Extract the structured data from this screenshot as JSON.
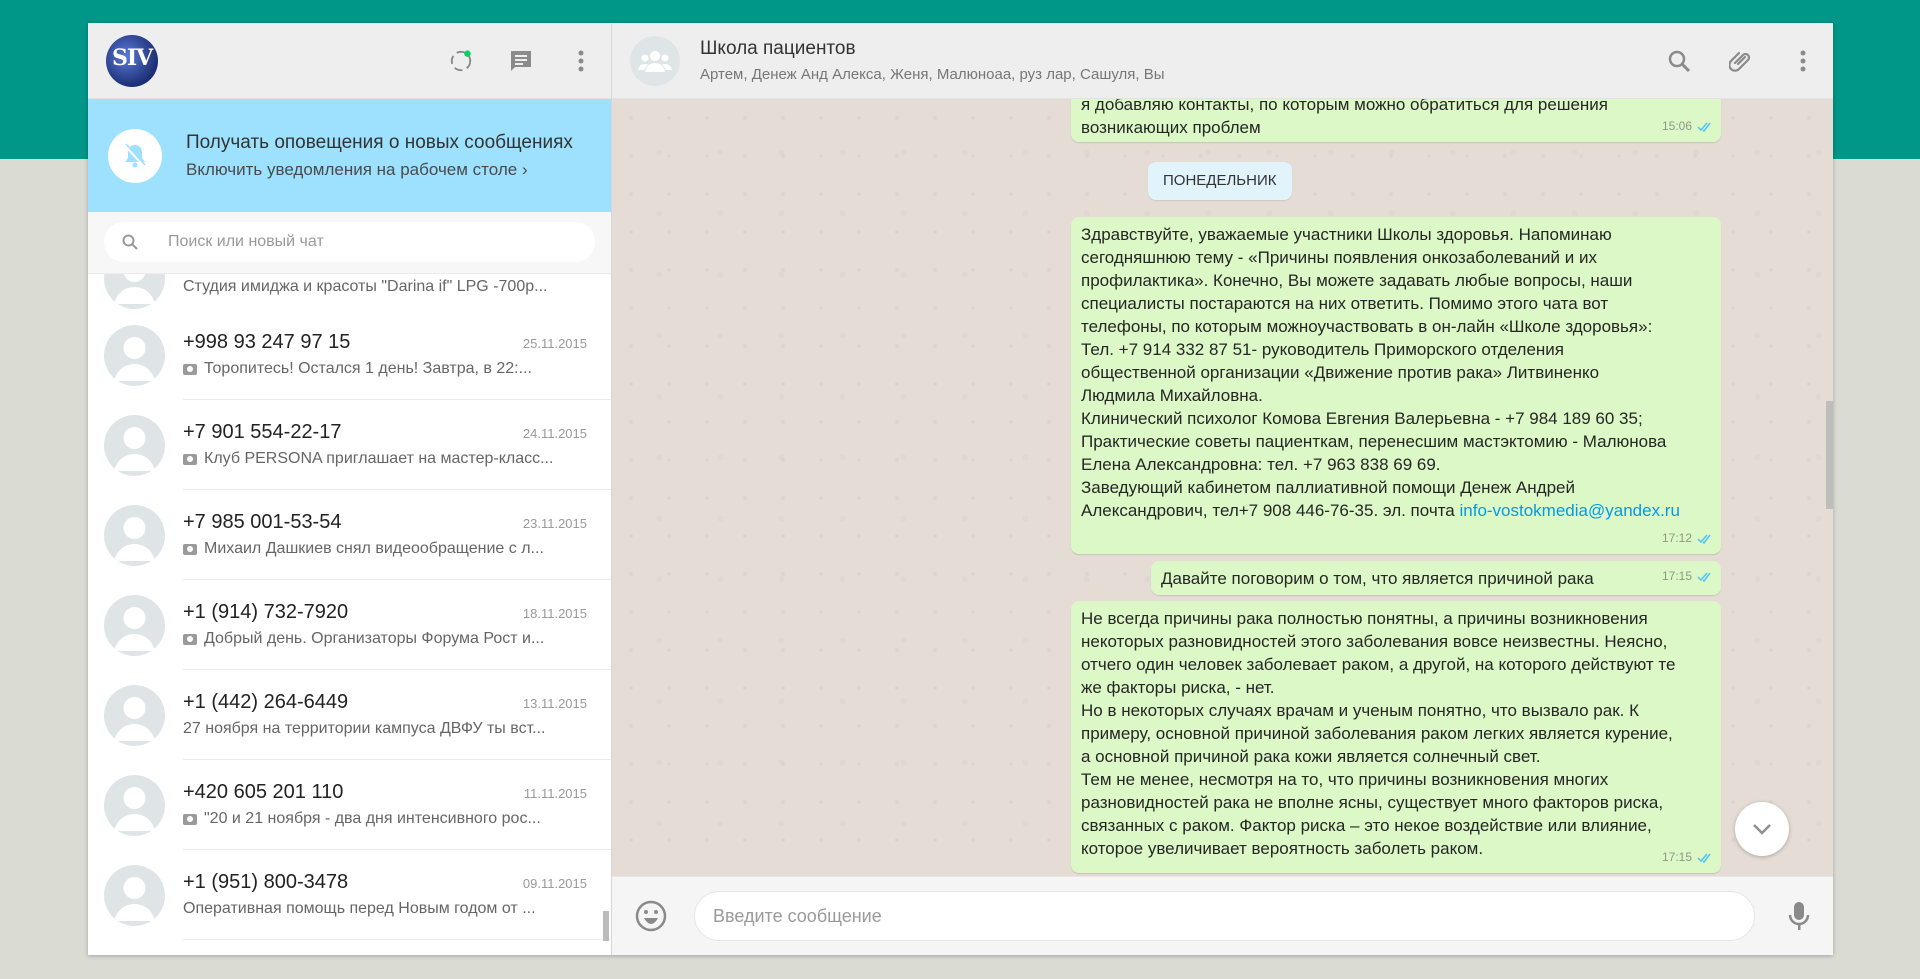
{
  "sidebar": {
    "notification": {
      "title": "Получать оповещения о новых сообщениях",
      "link": "Включить уведомления на рабочем столе ›"
    },
    "search": {
      "placeholder": "Поиск или новый чат"
    },
    "partial_chat": {
      "preview": "Студия имиджа и красоты \"Darina if\" LPG -700р..."
    },
    "chats": [
      {
        "name": "+998 93 247 97 15",
        "date": "25.11.2015",
        "has_photo": true,
        "preview": "Торопитесь!  Остался 1 день!     Завтра, в 22:..."
      },
      {
        "name": "+7 901 554-22-17",
        "date": "24.11.2015",
        "has_photo": true,
        "preview": "Клуб PERSONA приглашает на мастер-класс..."
      },
      {
        "name": "+7 985 001-53-54",
        "date": "23.11.2015",
        "has_photo": true,
        "preview": "Михаил Дашкиев снял видеообращение с л..."
      },
      {
        "name": "+1 (914) 732-7920",
        "date": "18.11.2015",
        "has_photo": true,
        "preview": "Добрый день. Организаторы Форума Рост и..."
      },
      {
        "name": "+1 (442) 264-6449",
        "date": "13.11.2015",
        "has_photo": false,
        "preview": "27 ноября на территории кампуса ДВФУ ты вст..."
      },
      {
        "name": "+420 605 201 110",
        "date": "11.11.2015",
        "has_photo": true,
        "preview": "\"20 и 21 ноября - два дня интенсивного рос..."
      },
      {
        "name": "+1 (951) 800-3478",
        "date": "09.11.2015",
        "has_photo": false,
        "preview": "Оперативная помощь перед Новым годом от ..."
      }
    ]
  },
  "conversation": {
    "title": "Школа пациентов",
    "members": "Артем, Денеж Анд Алекса, Женя, Малюноаа, руз лар, Сашуля, Вы",
    "day_divider": "ПОНЕДЕЛЬНИК",
    "messages": [
      {
        "lines": [
          "я добавляю контакты, по которым можно обратиться для решения",
          "возникающих проблем"
        ],
        "time": "15:06"
      },
      {
        "lines": [
          "Здравствуйте, уважаемые участники Школы здоровья. Напоминаю",
          "сегодняшнюю тему - «Причины появления онкозаболеваний и их",
          "профилактика». Конечно, Вы можете задавать любые вопросы, наши",
          "специалисты постараются на них ответить.  Помимо этого чата вот",
          "телефоны, по которым можноучаствовать в он-лайн «Школе здоровья»:",
          "Тел. +7 914 332 87 51- руководитель Приморского отделения",
          "общественной организации «Движение против рака» Литвиненко",
          "Людмила Михайловна.",
          "Клинический психолог Комова Евгения Валерьевна -   +7 984 189 60 35;",
          "Практические советы пациенткам, перенесшим мастэктомию - Малюнова",
          "Елена Александровна: тел. +7 963 838 69 69.",
          "Заведующий кабинетом паллиативной помощи  Денеж Андрей"
        ],
        "last_line_prefix": "Александрович, тел+7 908 446-76-35.  эл. почта ",
        "email": "info-vostokmedia@yandex.ru",
        "time": "17:12"
      },
      {
        "text": "Давайте поговорим о том, что является причиной рака",
        "time": "17:15"
      },
      {
        "lines": [
          "Не всегда причины рака полностью понятны, а причины возникновения",
          "некоторых разновидностей этого заболевания вовсе неизвестны. Неясно,",
          "отчего один человек заболевает раком, а другой, на которого действуют те",
          "же факторы риска, - нет.",
          "Но в некоторых случаях врачам и ученым понятно, что вызвало рак. К",
          "примеру, основной причиной заболевания раком легких является курение,",
          "а основной причиной рака кожи является солнечный свет.",
          "Тем не менее, несмотря на то, что причины возникновения многих",
          "разновидностей рака не вполне ясны, существует много факторов риска,",
          "связанных с раком. Фактор риска – это некое воздействие или влияние,",
          "которое увеличивает вероятность заболеть раком."
        ],
        "time": "17:15"
      }
    ]
  },
  "composer": {
    "placeholder": "Введите сообщение"
  },
  "colors": {
    "accent": "#009688",
    "outgoing_bubble": "#dcf8c6",
    "notification_bg": "#9de1fe",
    "read_ticks": "#4fc3f7"
  },
  "icons": [
    "status-icon",
    "new-chat-icon",
    "menu-icon",
    "bell-off-icon",
    "search-icon",
    "attach-icon",
    "emoji-icon",
    "mic-icon",
    "chevron-down-icon",
    "group-avatar-icon"
  ]
}
